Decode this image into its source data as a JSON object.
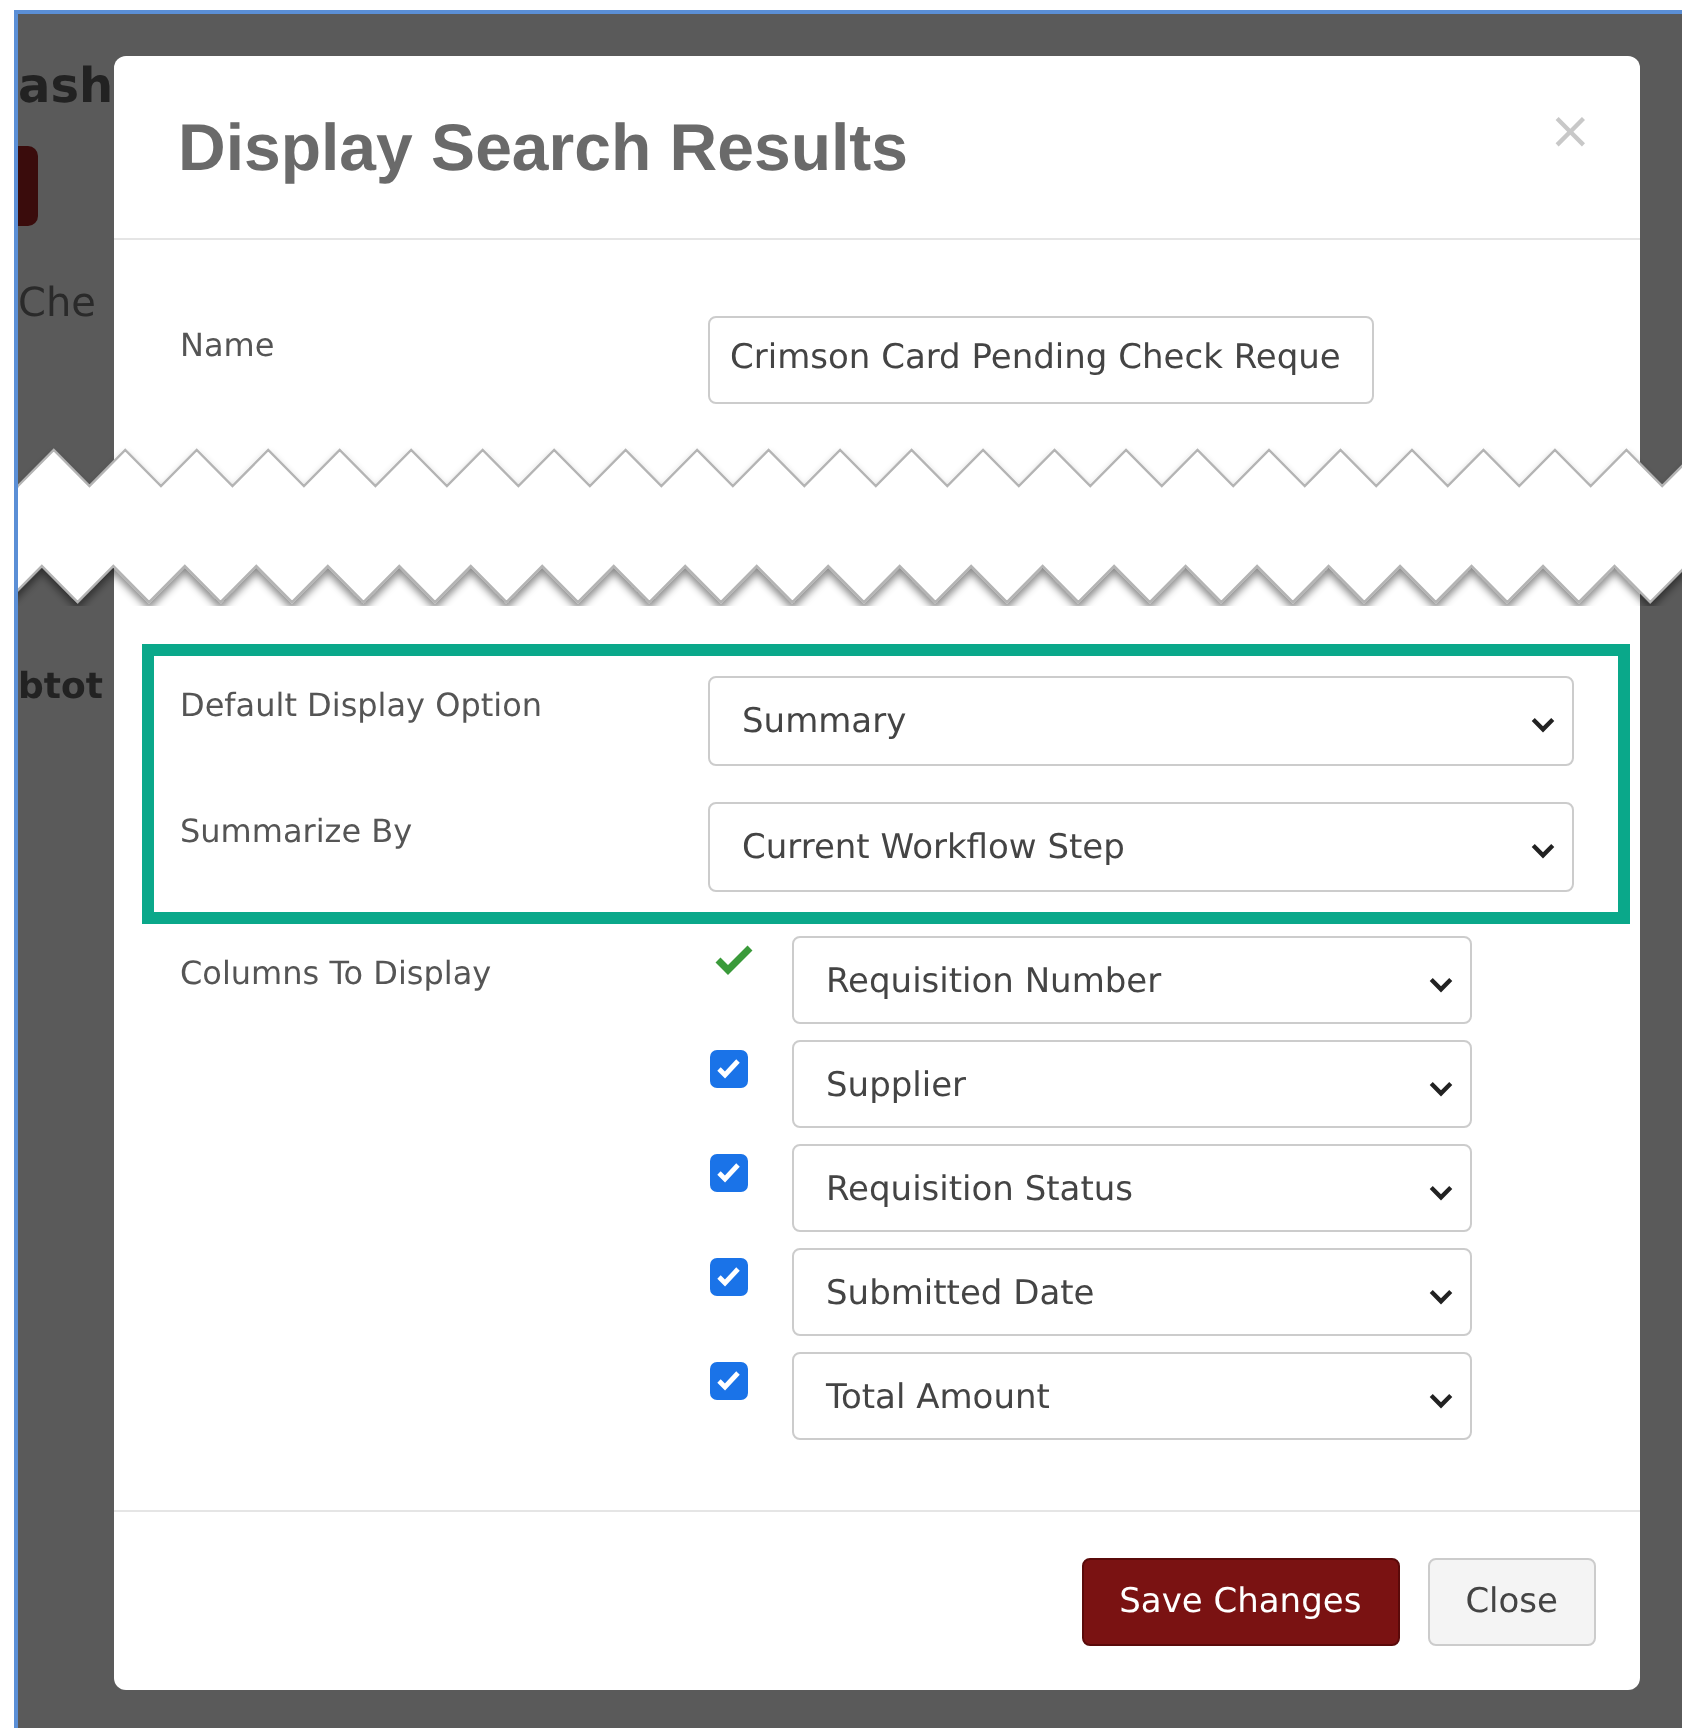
{
  "background_page": {
    "heading_fragment": "ash",
    "row_fragment": "Che",
    "column_fragment": "btot"
  },
  "dialog": {
    "title": "Display Search Results",
    "close": "×",
    "name": {
      "label": "Name",
      "value": "Crimson Card Pending Check Reque"
    },
    "default_display_option": {
      "label": "Default Display Option",
      "value": "Summary"
    },
    "summarize_by": {
      "label": "Summarize By",
      "value": "Current Workflow Step"
    },
    "highlighted": true,
    "columns_label": "Columns To Display",
    "columns": [
      {
        "kind": "fixed",
        "checked": true,
        "value": "Requisition Number"
      },
      {
        "kind": "checkbox",
        "checked": true,
        "value": "Supplier"
      },
      {
        "kind": "checkbox",
        "checked": true,
        "value": "Requisition Status"
      },
      {
        "kind": "checkbox",
        "checked": true,
        "value": "Submitted Date"
      },
      {
        "kind": "checkbox",
        "checked": true,
        "value": "Total Amount"
      }
    ],
    "buttons": [
      {
        "kind": "primary",
        "label": "Save Changes"
      },
      {
        "kind": "secondary",
        "label": "Close"
      }
    ]
  }
}
